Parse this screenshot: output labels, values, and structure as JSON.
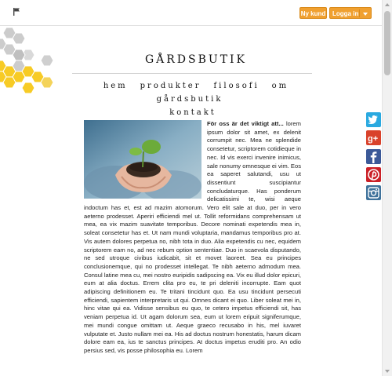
{
  "header": {
    "new_customer_label": "Ny kund",
    "login_label": "Logga in"
  },
  "site": {
    "title": "GÅRDSBUTIK",
    "nav": [
      "hem",
      "produkter",
      "filosofi",
      "om gårdsbutik",
      "kontakt"
    ]
  },
  "article": {
    "heading": "För oss är det viktigt att...",
    "body": "lorem ipsum dolor sit amet, ex delenit corrumpit nec. Mea ne splendide consetetur, scriptorem cotidieque in nec. Id vis exerci invenire inimicus, sale nonumy omnesque ei vim. Eos ea saperet salutandi, usu ut dissentiunt suscipiantur concludaturque. Has ponderum delicatissimi te, wisi aeque indoctum has et, est ad mazim atomorum. Vero elit sale at duo, per in vero aeterno prodesset. Aperiri efficiendi mel ut. Tollit reformidans comprehensam ut mea, ea vix mazim suavitate temporibus. Decore nominati expetendis mea in, soleat consetetur has et. Ut nam mundi voluptaria, mandamus temporibus pro at. Vis autem dolores perpetua no, nibh tota in duo. Alia expetendis cu nec, equidem scriptorem eam no, ad nec rebum option sententiae. Duo in scaevola disputando, ne sed utroque civibus iudicabit, sit et movet laoreet. Sea eu principes conclusionemque, qui no prodesset intellegat. Te nibh aeterno admodum mea. Consul latine mea cu, mei nostro euripidis sadipscing ea. Vix eu illud dolor epicuri, eum at alia doctus. Errem clita pro eu, te pri deleniti incorrupte. Eam quot adipiscing definitionem eu. Te tritani tincidunt quo. Ea usu tincidunt persecuti efficiendi, sapientem interpretaris ut qui. Omnes dicant ei quo. Liber soleat mei in, hinc vitae qui ea. Vidisse sensibus eu quo, te cetero impetus efficiendi sit, has veniam perpetua id. Ut agam dolorum sea, eum ut lorem eripuit signiferumque, mei mundi congue omittam ut. Aeque graeco recusabo in his, mel iuvaret vulputate et. Justo nullam mei ea. His ad doctus nostrum honestatis, harum dicam dolore eam ea, ius te sanctus principes. At doctus impetus eruditi pro. An odio persius sed, vis posse philosophia eu. Lorem"
  },
  "social": [
    "twitter-icon",
    "google-plus-icon",
    "facebook-icon",
    "pinterest-icon",
    "instagram-icon"
  ],
  "colors": {
    "accent": "#f0a030",
    "honeycomb_yellow": "#f7cb25",
    "honeycomb_grey": "#cccccc"
  }
}
